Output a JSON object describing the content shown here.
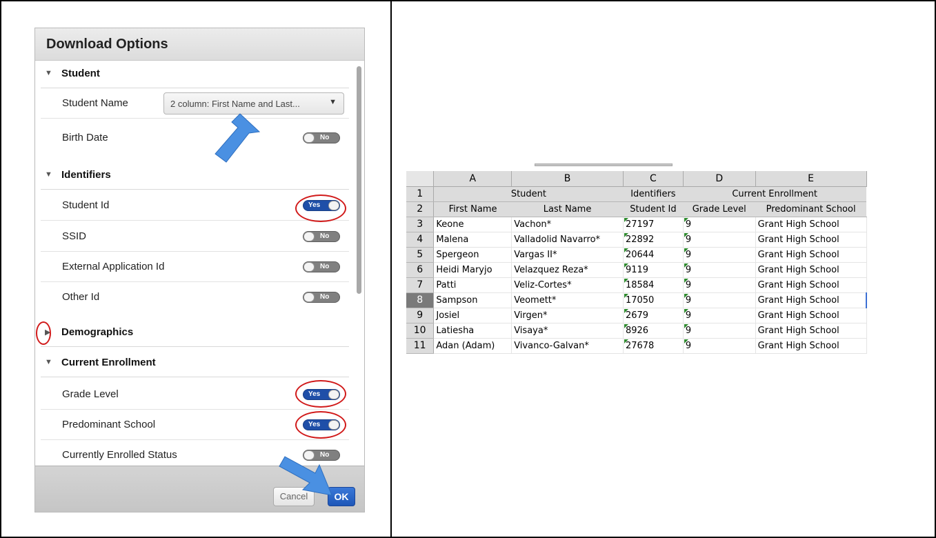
{
  "dialog": {
    "title": "Download Options",
    "sections": {
      "student": "Student",
      "identifiers": "Identifiers",
      "demographics": "Demographics",
      "current_enrollment": "Current Enrollment"
    },
    "rows": {
      "student_name": "Student Name",
      "student_name_value": "2 column: First Name and Last...",
      "birth_date": "Birth Date",
      "student_id": "Student Id",
      "ssid": "SSID",
      "external_app_id": "External Application Id",
      "other_id": "Other Id",
      "grade_level": "Grade Level",
      "predominant_school": "Predominant School",
      "currently_enrolled_status": "Currently Enrolled Status"
    },
    "toggle_on": "Yes",
    "toggle_off": "No",
    "toggles": {
      "birth_date": false,
      "student_id": true,
      "ssid": false,
      "external_app_id": false,
      "other_id": false,
      "grade_level": true,
      "predominant_school": true,
      "currently_enrolled_status": false
    },
    "buttons": {
      "cancel": "Cancel",
      "ok": "OK"
    },
    "colors": {
      "toggle_on": "#1f4fa8",
      "toggle_off": "#808080",
      "annotation": "#d11a1a",
      "arrow": "#4a90e2"
    }
  },
  "sheet": {
    "columns": [
      "A",
      "B",
      "C",
      "D",
      "E"
    ],
    "row_numbers": [
      "1",
      "2",
      "3",
      "4",
      "5",
      "6",
      "7",
      "8",
      "9",
      "10",
      "11"
    ],
    "group_headers": {
      "student": "Student",
      "identifiers": "Identifiers",
      "current_enrollment": "Current Enrollment"
    },
    "sub_headers": [
      "First Name",
      "Last Name",
      "Student Id",
      "Grade Level",
      "Predominant School"
    ],
    "rows": [
      [
        "Keone",
        "Vachon*",
        "27197",
        "9",
        "Grant High School"
      ],
      [
        "Malena",
        "Valladolid Navarro*",
        "22892",
        "9",
        "Grant High School"
      ],
      [
        "Spergeon",
        "Vargas II*",
        "20644",
        "9",
        "Grant High School"
      ],
      [
        "Heidi Maryjo",
        "Velazquez Reza*",
        "9119",
        "9",
        "Grant High School"
      ],
      [
        "Patti",
        "Veliz-Cortes*",
        "18584",
        "9",
        "Grant High School"
      ],
      [
        "Sampson",
        "Veomett*",
        "17050",
        "9",
        "Grant High School"
      ],
      [
        "Josiel",
        "Virgen*",
        "2679",
        "9",
        "Grant High School"
      ],
      [
        "Latiesha",
        "Visaya*",
        "8926",
        "9",
        "Grant High School"
      ],
      [
        "Adan (Adam)",
        "Vivanco-Galvan*",
        "27678",
        "9",
        "Grant High School"
      ]
    ],
    "selected_row": "8"
  }
}
